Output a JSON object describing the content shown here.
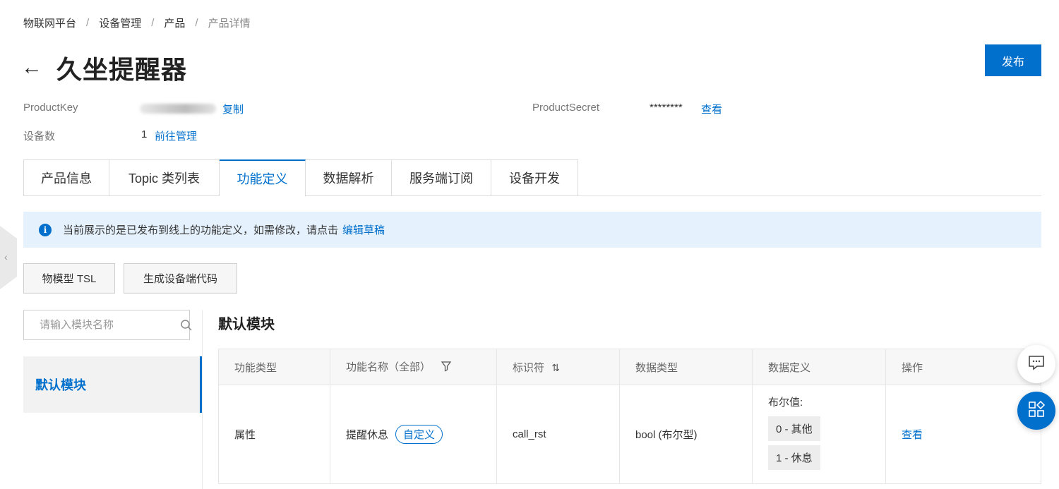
{
  "breadcrumb": [
    "物联网平台",
    "设备管理",
    "产品",
    "产品详情"
  ],
  "header": {
    "back": "←",
    "title": "久坐提醒器",
    "publish_label": "发布"
  },
  "meta": {
    "product_key_label": "ProductKey",
    "copy_label": "复制",
    "product_secret_label": "ProductSecret",
    "product_secret_value": "********",
    "view_secret_label": "查看",
    "device_count_label": "设备数",
    "device_count_value": "1",
    "manage_label": "前往管理"
  },
  "tabs": [
    {
      "label": "产品信息",
      "active": false
    },
    {
      "label": "Topic 类列表",
      "active": false
    },
    {
      "label": "功能定义",
      "active": true
    },
    {
      "label": "数据解析",
      "active": false
    },
    {
      "label": "服务端订阅",
      "active": false
    },
    {
      "label": "设备开发",
      "active": false
    }
  ],
  "notice": {
    "text": "当前展示的是已发布到线上的功能定义，如需修改，请点击",
    "link": "编辑草稿"
  },
  "actions": {
    "tsl_label": "物模型 TSL",
    "gen_code_label": "生成设备端代码"
  },
  "search": {
    "placeholder": "请输入模块名称"
  },
  "module_list": [
    "默认模块"
  ],
  "module": {
    "title": "默认模块"
  },
  "table": {
    "headers": {
      "type": "功能类型",
      "name": "功能名称（全部）",
      "identifier": "标识符",
      "data_type": "数据类型",
      "data_def": "数据定义",
      "action": "操作"
    },
    "rows": [
      {
        "type": "属性",
        "name": "提醒休息",
        "tag": "自定义",
        "identifier": "call_rst",
        "data_type": "bool (布尔型)",
        "def_label": "布尔值:",
        "def_values": [
          "0 - 其他",
          "1 - 休息"
        ],
        "action": "查看"
      }
    ]
  },
  "colors": {
    "accent": "#0070cc",
    "notice_bg": "#e5f1fc"
  }
}
